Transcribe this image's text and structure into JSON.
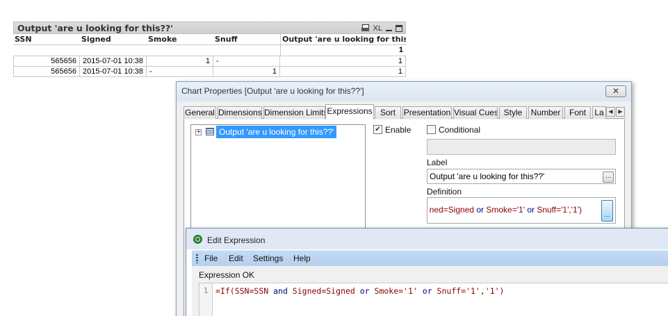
{
  "table": {
    "title": "Output 'are u looking for this??'",
    "caption_icons": [
      "print-icon",
      "XL",
      "minimize-icon",
      "maximize-icon"
    ],
    "xl_label": "XL",
    "columns": [
      "SSN",
      "Signed",
      "Smoke",
      "Snuff",
      "Output 'are u looking for this??'"
    ],
    "total": "1",
    "rows": [
      [
        "565656",
        "2015-07-01 10:38",
        "1",
        "-",
        "1"
      ],
      [
        "565656",
        "2015-07-01 10:38",
        "-",
        "1",
        "1"
      ]
    ]
  },
  "chart_properties": {
    "title": "Chart Properties [Output 'are u looking for this??']",
    "close_label": "✕",
    "tabs": [
      "General",
      "Dimensions",
      "Dimension Limits",
      "Expressions",
      "Sort",
      "Presentation",
      "Visual Cues",
      "Style",
      "Number",
      "Font",
      "La"
    ],
    "active_tab": "Expressions",
    "tree_item": "Output 'are u looking for this??'",
    "enable_label": "Enable",
    "enable_checked": true,
    "conditional_label": "Conditional",
    "conditional_checked": false,
    "label_caption": "Label",
    "label_value": "Output 'are u looking for this??'",
    "definition_caption": "Definition",
    "definition": {
      "p1": "ned=Signed ",
      "k1": "or",
      "p2": " Smoke='1' ",
      "k2": "or",
      "p3": " Snuff='1','1')"
    },
    "dots": "..."
  },
  "edit_expression": {
    "title": "Edit Expression",
    "menu": [
      "File",
      "Edit",
      "Settings",
      "Help"
    ],
    "status": "Expression OK",
    "line_number": "1",
    "code": {
      "a": "=If(SSN=SSN ",
      "k1": "and",
      "b": " Signed=Signed ",
      "k2": "or",
      "c": " Smoke='1' ",
      "k3": "or",
      "d": " Snuff='1','1')"
    }
  },
  "colors": {
    "selection": "#3399ff",
    "menubar": "#c5dbf5",
    "keyword": "#00008b",
    "string": "#8b0000"
  }
}
